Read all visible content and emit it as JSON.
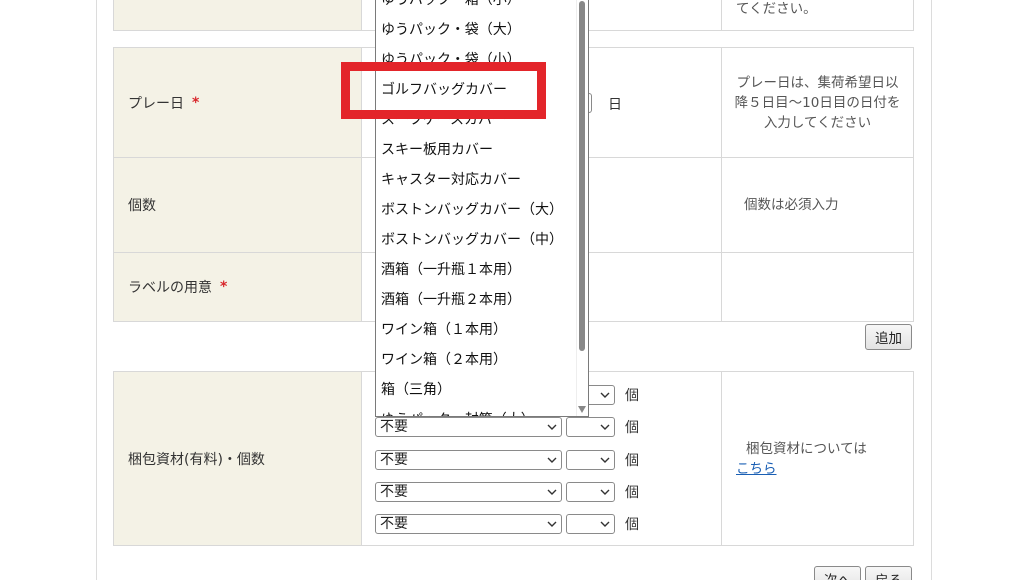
{
  "rows": {
    "top_note": "てください。",
    "play_day": {
      "label": "プレー日",
      "required_mark": "*",
      "day_unit": "日",
      "note": "プレー日は、集荷希望日以降５日目〜10日目の日付を入力してください"
    },
    "count": {
      "label": "個数",
      "note": "個数は必須入力"
    },
    "label_prep": {
      "label": "ラベルの用意",
      "required_mark": "*"
    }
  },
  "add_button": "追加",
  "packaging": {
    "label": "梱包資材(有料)・個数",
    "note_text": "梱包資材については",
    "note_link": "こちら",
    "unit": "個",
    "selects": [
      {
        "value": "",
        "qty": ""
      },
      {
        "value": "不要",
        "qty": ""
      },
      {
        "value": "不要",
        "qty": ""
      },
      {
        "value": "不要",
        "qty": ""
      },
      {
        "value": "不要",
        "qty": ""
      }
    ]
  },
  "dropdown": {
    "options": [
      "ゆうパック・箱（小）",
      "ゆうパック・袋（大）",
      "ゆうパック・袋（小）",
      "ゴルフバッグカバー",
      "スーツケースカバー",
      "スキー板用カバー",
      "キャスター対応カバー",
      "ボストンバッグカバー（大）",
      "ボストンバッグカバー（中）",
      "酒箱（一升瓶１本用）",
      "酒箱（一升瓶２本用）",
      "ワイン箱（１本用）",
      "ワイン箱（２本用）",
      "箱（三角）",
      "ゆうパック・封筒（大）"
    ],
    "highlighted_index": 3
  },
  "footer_buttons": {
    "next": "次へ",
    "back": "戻る"
  },
  "colors": {
    "label_bg": "#f4f2e6",
    "required": "#d8262b",
    "highlight": "#e3252a",
    "link": "#1a5fb4"
  }
}
